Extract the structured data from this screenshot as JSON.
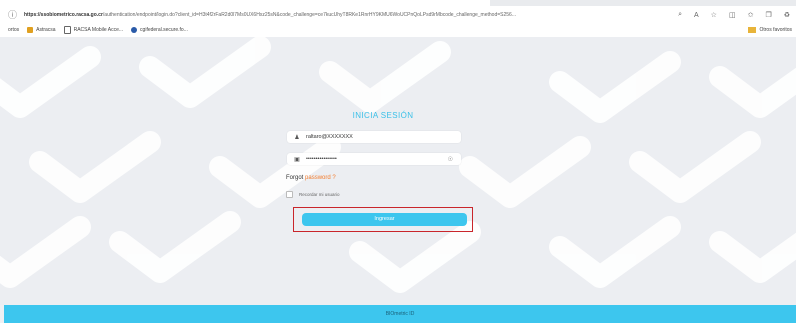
{
  "browser": {
    "url_domain": "https://ssobiometrico.racsa.go.cr",
    "url_rest": "/authentication/endpoint/login.do?client_id=H3t4f2rFaR2d0l7Ms0UX6Hxz25sN&code_challenge=ce7kucUhyT8RKe1RnrHY9KMU6WoUCPnQoLPsd9rMbcode_challenge_method=S256..."
  },
  "bookmarks": {
    "items": [
      {
        "label": "ortos",
        "color": "#999999"
      },
      {
        "label": "Astracsa",
        "color": "#e0a020"
      },
      {
        "label": "RACSA Mobile Acce...",
        "color": "#666666"
      },
      {
        "label": "cgifederal.secure.fo...",
        "color": "#2a5aa8"
      }
    ],
    "right_folder": "Otros favoritos"
  },
  "login": {
    "title": "INICIA SESIÓN",
    "username_value": "raltaro@XXXXXXX",
    "password_value": "••••••••••••••••",
    "forgot_text": "Forgot",
    "forgot_link": "password",
    "forgot_suffix": "?",
    "remember_label": "Recordar mi usuario",
    "submit_label": "Ingresar"
  },
  "footer": {
    "text": "BIOmetric ID"
  },
  "colors": {
    "accent": "#3dc6ee",
    "highlight": "#c9252b",
    "link": "#f47c2c"
  }
}
